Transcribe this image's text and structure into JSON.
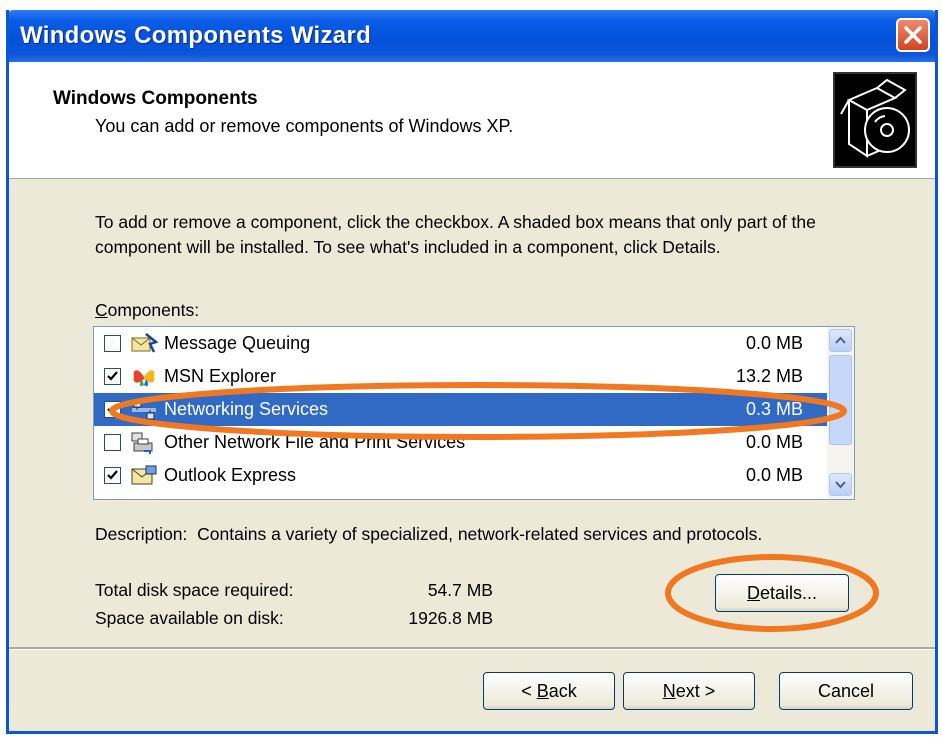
{
  "window": {
    "title": "Windows Components Wizard"
  },
  "header": {
    "title": "Windows Components",
    "subtitle": "You can add or remove components of Windows XP."
  },
  "instructions": "To add or remove a component, click the checkbox.  A shaded box means that only part of the component will be installed.  To see what's included in a component, click Details.",
  "components": {
    "label_u": "C",
    "label_rest": "omponents:",
    "items": [
      {
        "name": "Message Queuing",
        "size": "0.0 MB",
        "checked": false,
        "selected": false,
        "icon": "message-queuing-icon"
      },
      {
        "name": "MSN Explorer",
        "size": "13.2 MB",
        "checked": true,
        "selected": false,
        "icon": "msn-butterfly-icon"
      },
      {
        "name": "Networking Services",
        "size": "0.3 MB",
        "checked": true,
        "selected": true,
        "icon": "network-icon"
      },
      {
        "name": "Other Network File and Print Services",
        "size": "0.0 MB",
        "checked": false,
        "selected": false,
        "icon": "printer-icon"
      },
      {
        "name": "Outlook Express",
        "size": "0.0 MB",
        "checked": true,
        "selected": false,
        "icon": "outlook-express-icon"
      }
    ]
  },
  "description": {
    "label": "Description:",
    "text": "Contains a variety of specialized, network-related services and protocols."
  },
  "disk": {
    "required_label": "Total disk space required:",
    "required_value": "54.7 MB",
    "available_label": "Space available on disk:",
    "available_value": "1926.8 MB"
  },
  "buttons": {
    "details_u": "D",
    "details_rest": "etails...",
    "back_prefix": "< ",
    "back_u": "B",
    "back_rest": "ack",
    "next_u": "N",
    "next_rest": "ext >",
    "cancel": "Cancel"
  },
  "colors": {
    "selection": "#316ac5",
    "annotation": "#f07820",
    "titlebar": "#0452dc"
  }
}
